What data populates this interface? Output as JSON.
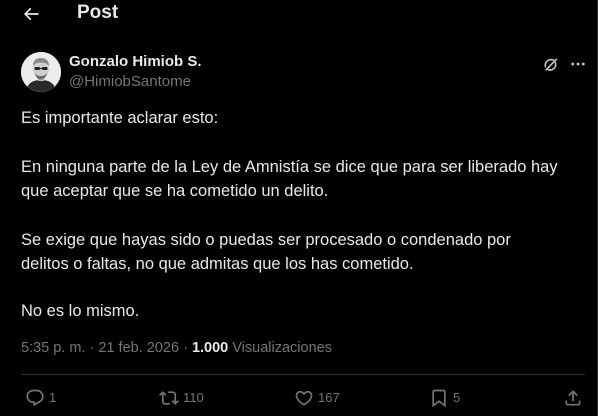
{
  "header": {
    "title": "Post"
  },
  "author": {
    "name": "Gonzalo Himiob S.",
    "handle": "@HimiobSantome"
  },
  "tweet": {
    "lines": [
      "Es importante aclarar esto:",
      "En ninguna parte de la Ley de Amnistía se dice que para ser liberado hay",
      "que aceptar que se ha cometido un delito.",
      "Se exige que hayas sido o puedas ser procesado o condenado por",
      "delitos o faltas, no que admitas que los has cometido.",
      "No es lo mismo."
    ]
  },
  "meta": {
    "time": "5:35 p. m.",
    "separator": "·",
    "date": "21 feb. 2026",
    "views_count": "1.000",
    "views_label": "Visualizaciones"
  },
  "actions": {
    "replies": "1",
    "reposts": "110",
    "likes": "167",
    "bookmarks": "5"
  },
  "icons": {
    "back": "arrow-left-icon",
    "grok": "grok-icon",
    "more": "more-horizontal-icon",
    "reply": "reply-icon",
    "repost": "repost-icon",
    "like": "heart-icon",
    "bookmark": "bookmark-icon",
    "share": "share-icon"
  },
  "colors": {
    "background": "#000000",
    "text": "#e7e9ea",
    "muted": "#71767b",
    "border": "#2f3336"
  }
}
